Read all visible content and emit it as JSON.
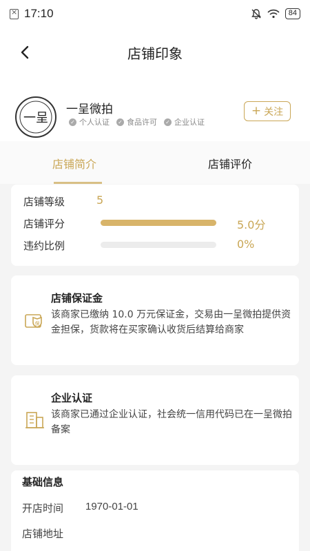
{
  "status_bar": {
    "time": "17:10",
    "battery": "84"
  },
  "nav": {
    "title": "店铺印象"
  },
  "shop": {
    "name": "一呈微拍",
    "logo_text": "一呈",
    "certs": [
      "个人认证",
      "食品许可",
      "企业认证"
    ],
    "follow_label": "关注"
  },
  "tabs": [
    {
      "label": "店铺简介"
    },
    {
      "label": "店铺评价"
    }
  ],
  "stats": {
    "level_label": "店铺等级",
    "level_value": "5",
    "score_label": "店铺评分",
    "score_value": "5.0分",
    "score_fraction": 1.0,
    "violation_label": "违约比例",
    "violation_value": "0%",
    "violation_fraction": 0.0
  },
  "deposit": {
    "title": "店铺保证金",
    "text": "该商家已缴纳 10.0 万元保证金，交易由一呈微拍提供资金担保，货款将在买家确认收货后结算给商家",
    "icon_text": "保"
  },
  "corp": {
    "title": "企业认证",
    "text": "该商家已通过企业认证，社会统一信用代码已在一呈微拍备案"
  },
  "basic": {
    "title": "基础信息",
    "open_time_label": "开店时间",
    "open_time_value": "1970-01-01",
    "address_label": "店铺地址"
  },
  "colors": {
    "accent": "#c9a655",
    "bar": "#d8b46a"
  }
}
